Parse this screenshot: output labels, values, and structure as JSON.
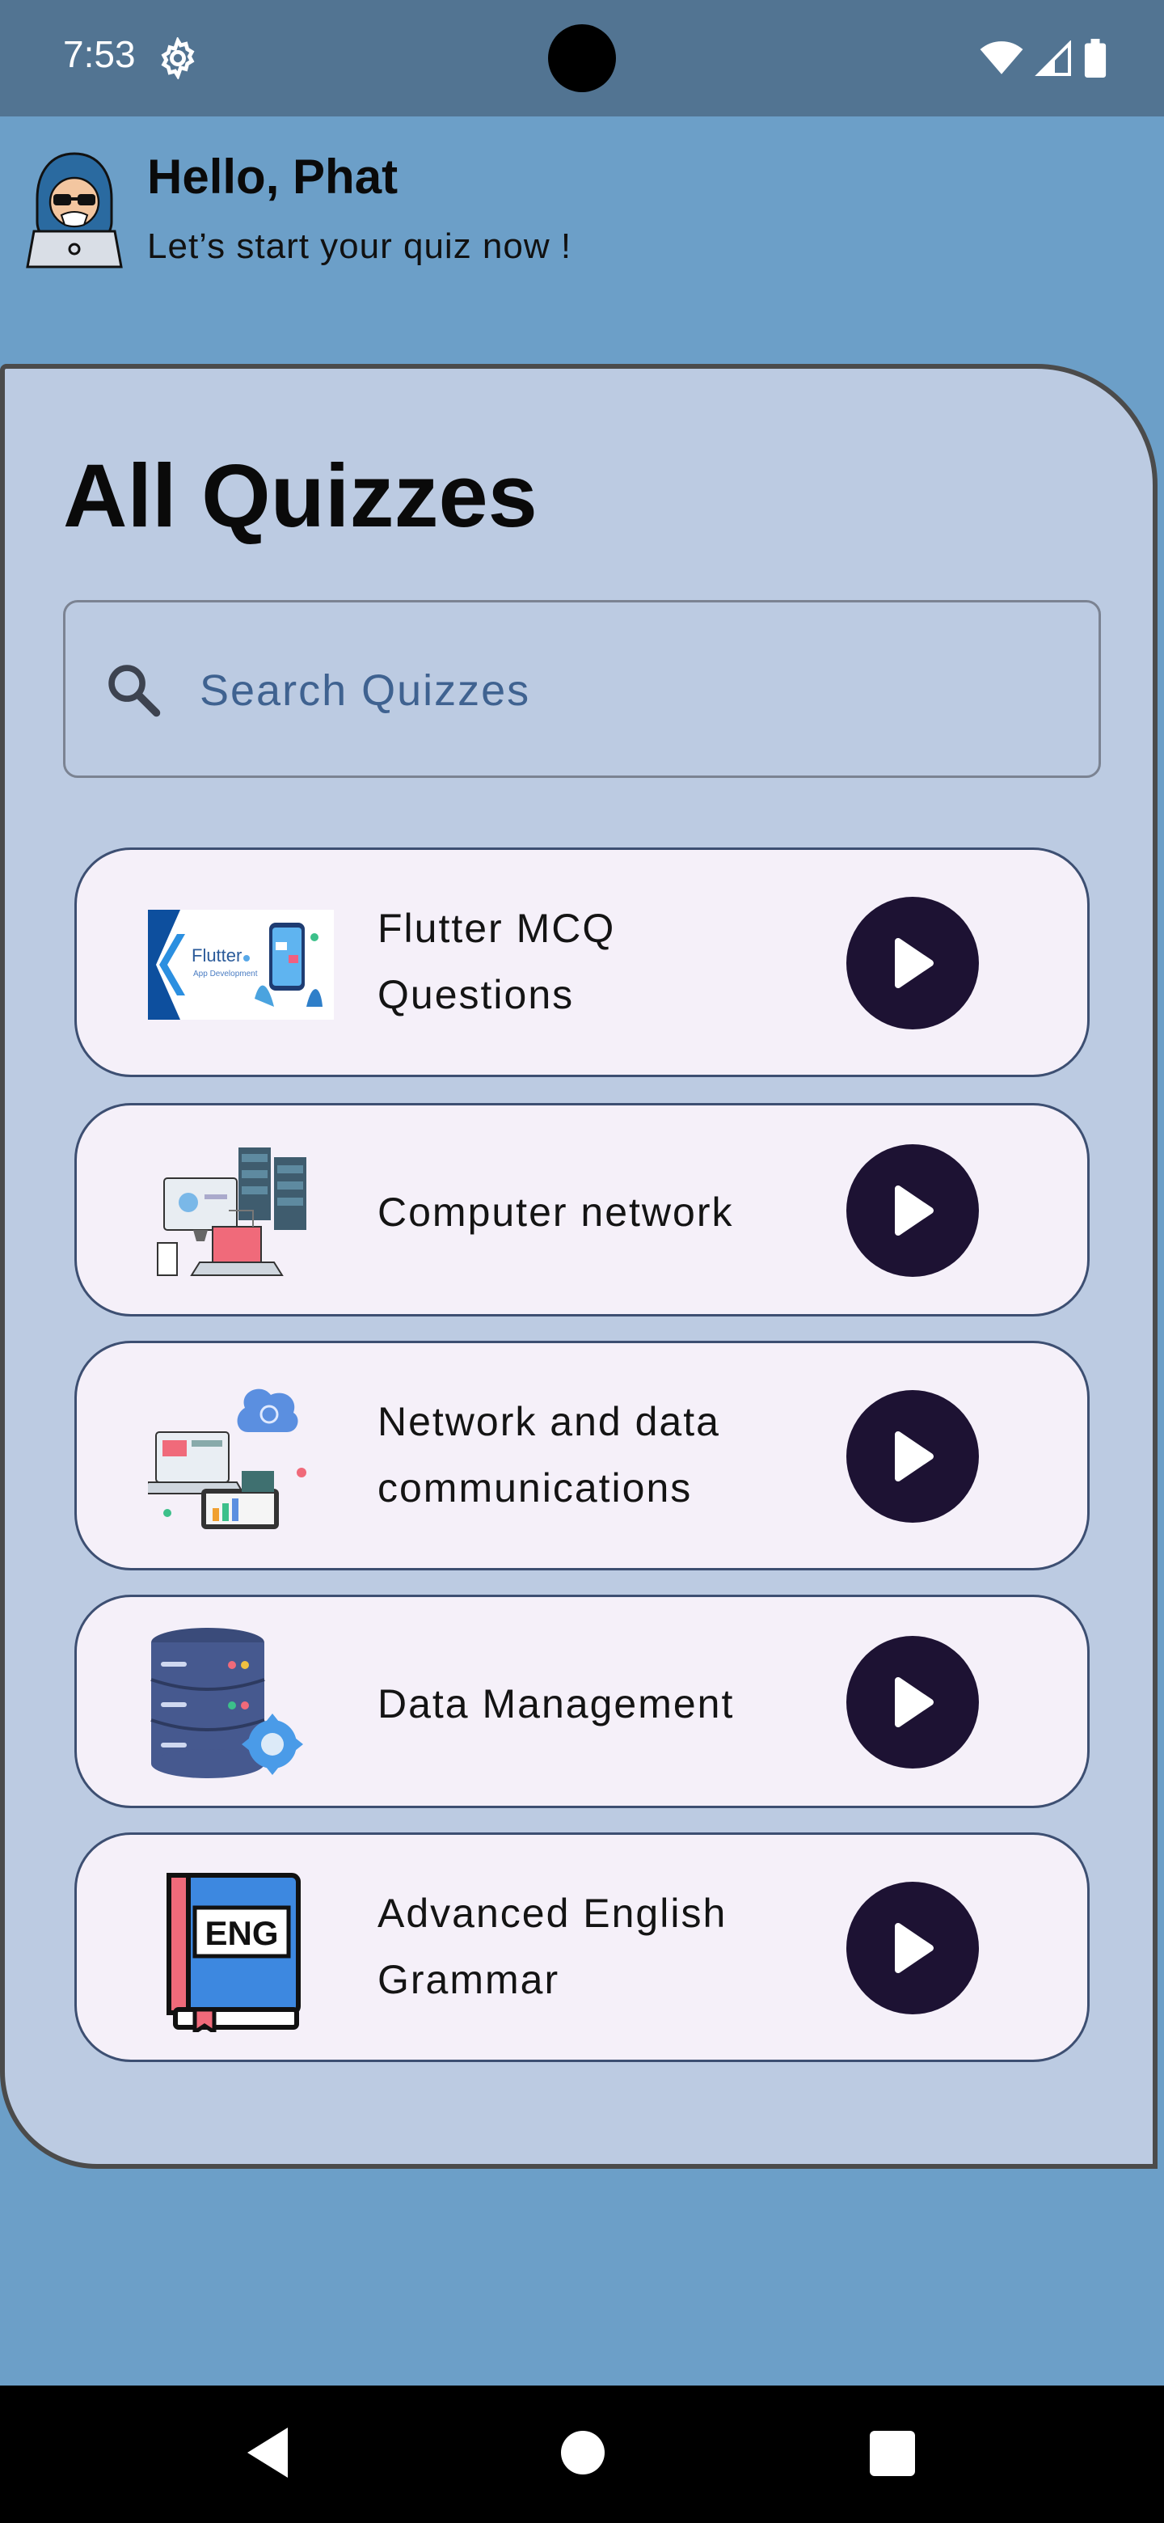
{
  "status": {
    "time": "7:53"
  },
  "header": {
    "greeting": "Hello, Phat",
    "subtitle": "Let’s start your quiz now !"
  },
  "main": {
    "title": "All Quizzes",
    "search": {
      "placeholder": "Search Quizzes",
      "value": ""
    },
    "quizzes": [
      {
        "title": "Flutter MCQ Questions",
        "thumbnail": "flutter-app-development-image",
        "action": "play-icon"
      },
      {
        "title": "Computer network",
        "thumbnail": "computer-network-image",
        "action": "play-icon"
      },
      {
        "title": "Network and data communications",
        "thumbnail": "data-communications-image",
        "action": "play-icon"
      },
      {
        "title": "Data Management",
        "thumbnail": "database-gear-image",
        "action": "play-icon"
      },
      {
        "title": "Advanced English Grammar",
        "thumbnail": "eng-book-image",
        "thumbnail_text": "ENG",
        "action": "play-icon"
      }
    ]
  },
  "colors": {
    "background": "#6c9fc8",
    "statusbar": "#527492",
    "panel": "#bccbe2",
    "card": "#f5f0f9",
    "play_button": "#1d1233"
  }
}
